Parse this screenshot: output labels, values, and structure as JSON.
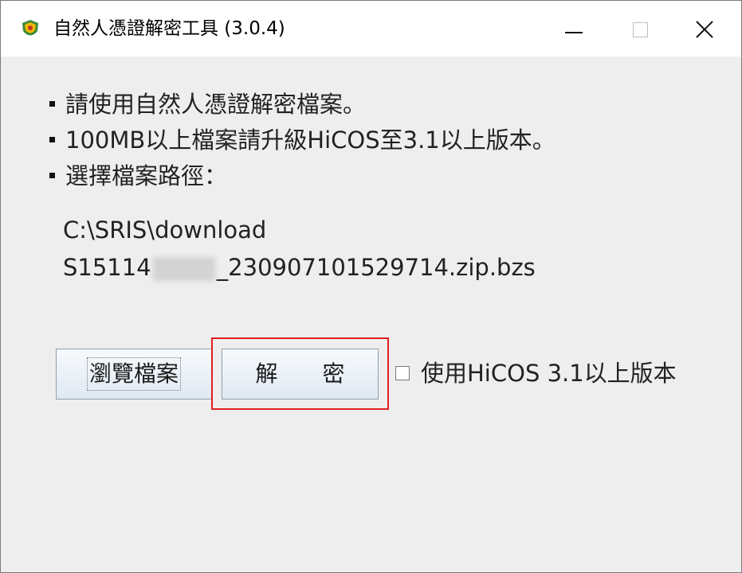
{
  "window": {
    "title": "自然人憑證解密工具 (3.0.4)"
  },
  "instructions": [
    "請使用自然人憑證解密檔案。",
    "100MB以上檔案請升級HiCOS至3.1以上版本。",
    "選擇檔案路徑："
  ],
  "file": {
    "directory": "C:\\SRIS\\download",
    "filename_prefix": "S15114",
    "filename_suffix": "_230907101529714.zip.bzs"
  },
  "buttons": {
    "browse_label": "瀏覽檔案",
    "decrypt_char_1": "解",
    "decrypt_char_2": "密"
  },
  "checkbox": {
    "label": "使用HiCOS 3.1以上版本",
    "checked": false
  },
  "icons": {
    "app": "app-shield-icon",
    "minimize": "minimize-icon",
    "maximize": "maximize-icon",
    "close": "close-icon"
  },
  "colors": {
    "highlight": "#e01f1f",
    "window_bg": "#eeeeee"
  }
}
